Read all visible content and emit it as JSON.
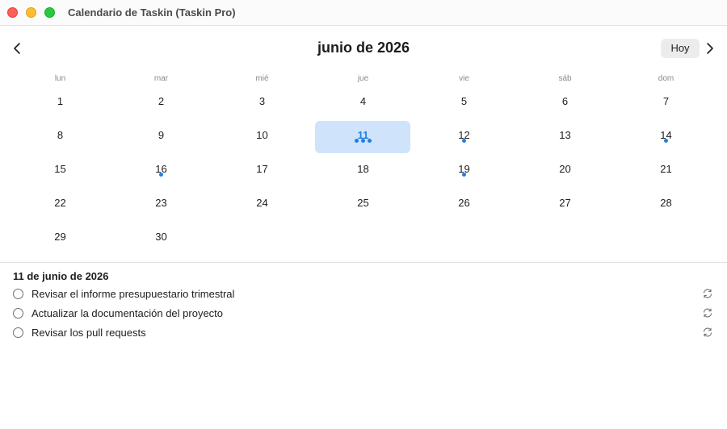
{
  "window": {
    "title": "Calendario de Taskin (Taskin Pro)"
  },
  "header": {
    "month_title": "junio de 2026",
    "today_label": "Hoy",
    "prev_icon": "chevron-left-icon",
    "next_icon": "chevron-right-icon"
  },
  "weekdays": [
    "lun",
    "mar",
    "mié",
    "jue",
    "vie",
    "sáb",
    "dom"
  ],
  "calendar": {
    "first_weekday_index": 0,
    "days_in_month": 30,
    "selected_day": 11,
    "accent_color": "#1f7fe6",
    "selected_bg": "#cfe3fb",
    "task_counts": {
      "11": 3,
      "12": 1,
      "14": 1,
      "16": 1,
      "19": 1
    }
  },
  "details": {
    "date_title": "11 de junio de 2026",
    "tasks": [
      {
        "text": "Revisar el informe presupuestario trimestral",
        "repeat_icon": "repeat-icon"
      },
      {
        "text": "Actualizar la documentación del proyecto",
        "repeat_icon": "repeat-icon"
      },
      {
        "text": "Revisar los pull requests",
        "repeat_icon": "repeat-icon"
      }
    ]
  }
}
